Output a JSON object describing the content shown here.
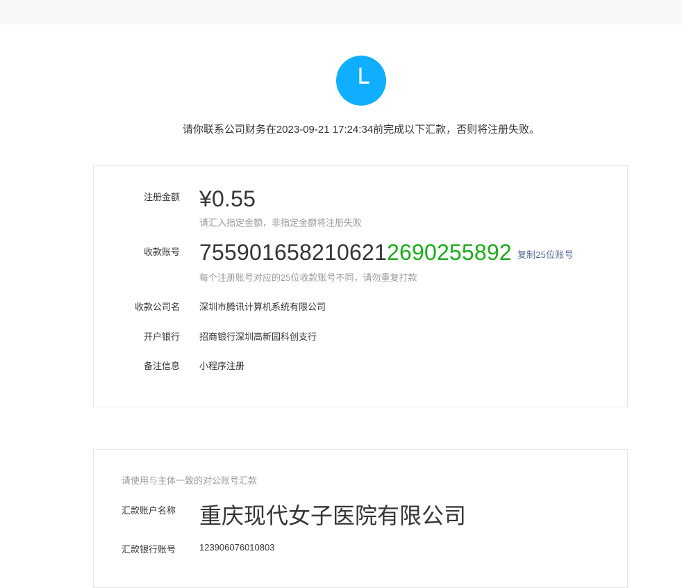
{
  "avatar": {
    "letter": "L",
    "color": "#10aeff"
  },
  "notice": "请你联系公司财务在2023-09-21 17:24:34前完成以下汇款，否则将注册失败。",
  "payment_card": {
    "amount_label": "注册金额",
    "amount_value": "¥0.55",
    "amount_hint": "请汇入指定金额，非指定金额将注册失败",
    "account_label": "收款账号",
    "account_prefix": "755901658210621",
    "account_suffix": "2690255892",
    "copy_link": "复制25位账号",
    "account_hint": "每个注册账号对应的25位收款账号不同，请勿重复打款",
    "company_label": "收款公司名",
    "company_value": "深圳市腾讯计算机系统有限公司",
    "bank_label": "开户银行",
    "bank_value": "招商银行深圳高新园科创支行",
    "remark_label": "备注信息",
    "remark_value": "小程序注册"
  },
  "payer_card": {
    "hint": "请使用与主体一致的对公账号汇款",
    "name_label": "汇款账户名称",
    "name_value": "重庆现代女子医院有限公司",
    "account_label": "汇款银行账号",
    "account_value": "123906076010803"
  }
}
